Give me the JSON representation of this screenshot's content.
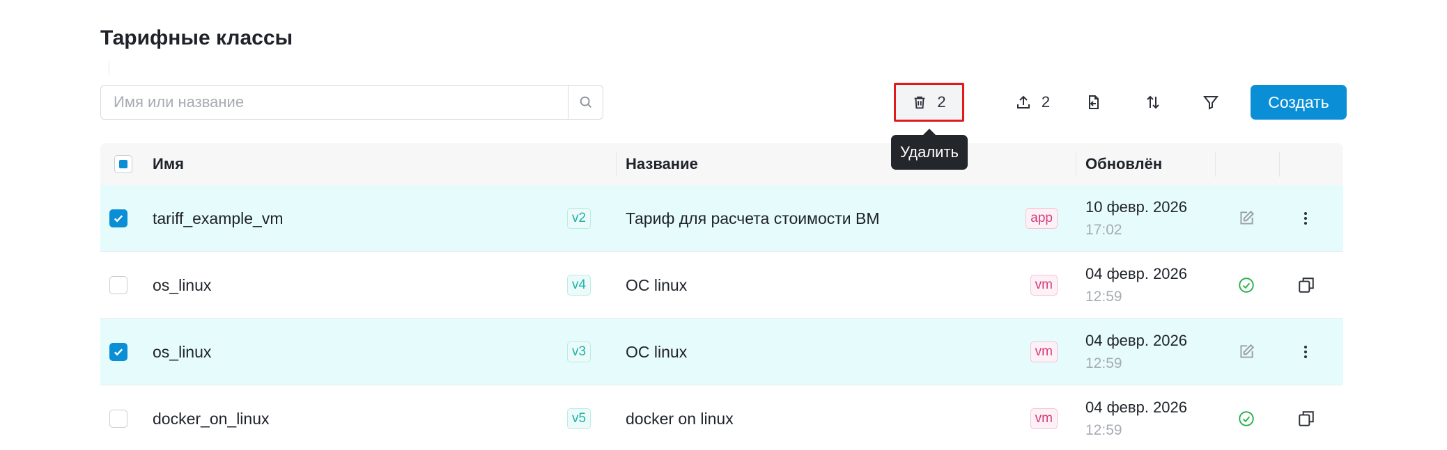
{
  "page": {
    "title": "Тарифные классы"
  },
  "search": {
    "placeholder": "Имя или название"
  },
  "toolbar": {
    "delete_count": "2",
    "upload_count": "2",
    "create_label": "Создать",
    "tooltip": "Удалить"
  },
  "table": {
    "columns": {
      "name": "Имя",
      "title": "Название",
      "updated": "Обновлён"
    },
    "rows": [
      {
        "selected": true,
        "name": "tariff_example_vm",
        "version": "v2",
        "title": "Тариф для расчета стоимости ВМ",
        "tag": "app",
        "date": "10 февр. 2026",
        "time": "17:02",
        "status_icon": "edit-icon",
        "action_icon": "more-vertical-icon"
      },
      {
        "selected": false,
        "name": "os_linux",
        "version": "v4",
        "title": "ОС linux",
        "tag": "vm",
        "date": "04 февр. 2026",
        "time": "12:59",
        "status_icon": "check-circle-icon",
        "action_icon": "copy-icon"
      },
      {
        "selected": true,
        "name": "os_linux",
        "version": "v3",
        "title": "ОС linux",
        "tag": "vm",
        "date": "04 февр. 2026",
        "time": "12:59",
        "status_icon": "edit-icon",
        "action_icon": "more-vertical-icon"
      },
      {
        "selected": false,
        "name": "docker_on_linux",
        "version": "v5",
        "title": "docker on linux",
        "tag": "vm",
        "date": "04 февр. 2026",
        "time": "12:59",
        "status_icon": "check-circle-icon",
        "action_icon": "copy-icon"
      }
    ]
  },
  "colors": {
    "accent": "#0a8fd6",
    "selected_row": "#e6fbfb",
    "highlight_border": "#e01a1a",
    "success": "#2bb24c"
  }
}
